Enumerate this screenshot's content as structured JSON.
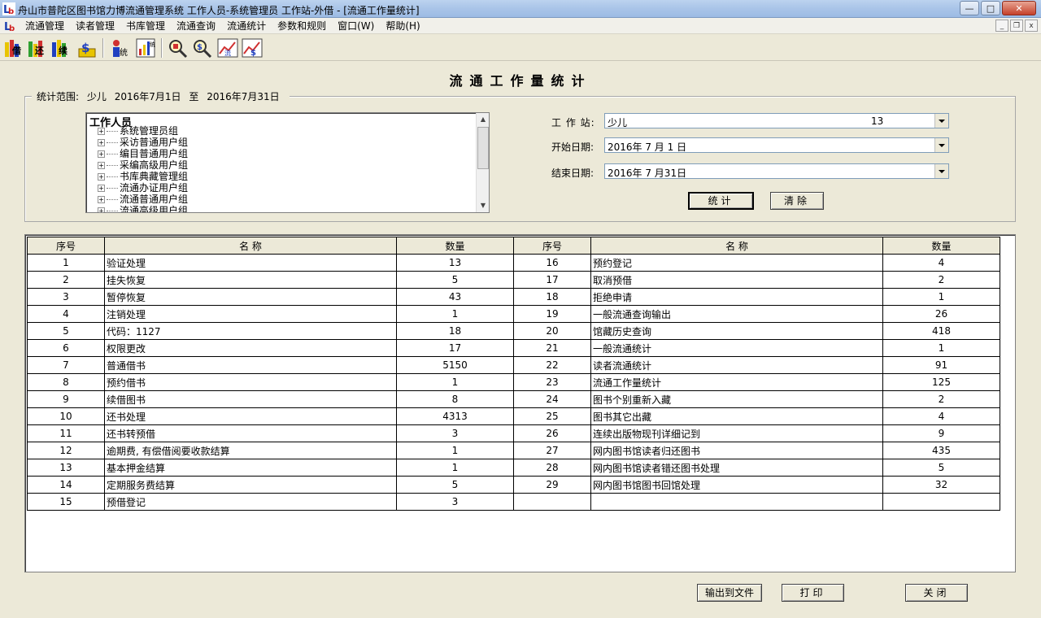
{
  "window": {
    "title": "舟山市普陀区图书馆力博流通管理系统 工作人员-系统管理员 工作站-外借 - [流通工作量统计]",
    "btn_min": "—",
    "btn_max": "□",
    "btn_close": "✕"
  },
  "menu": {
    "items": [
      "流通管理",
      "读者管理",
      "书库管理",
      "流通查询",
      "流通统计",
      "参数和规则",
      "窗口(W)",
      "帮助(H)"
    ],
    "mdi_min": "_",
    "mdi_restore": "❐",
    "mdi_close": "x"
  },
  "toolbar": {
    "icons": [
      "lend-icon",
      "return-icon",
      "renew-icon",
      "fee-icon",
      "reader-stats-icon",
      "stats-chart-icon",
      "search-book-icon",
      "search-fee-icon",
      "circulation-stats-icon",
      "fee-stats-icon"
    ],
    "labels": [
      "借",
      "还",
      "续",
      "$",
      "统",
      "统",
      "",
      "$",
      "流",
      "$"
    ]
  },
  "form": {
    "title": "流通工作量统计",
    "range_label": "统计范围:",
    "range_location": "少儿",
    "range_start": "2016年7月1日",
    "range_to": "至",
    "range_end": "2016年7月31日"
  },
  "tree": {
    "root": "工作人员",
    "nodes": [
      "系统管理员组",
      "采访普通用户组",
      "编目普通用户组",
      "采编高级用户组",
      "书库典藏管理组",
      "流通办证用户组",
      "流通普通用户组",
      "流通高级用户组"
    ]
  },
  "fields": {
    "station_label": "工 作 站:",
    "station_value": "少儿",
    "station_code": "13",
    "start_label": "开始日期:",
    "start_value": "2016年 7 月 1 日",
    "end_label": "结束日期:",
    "end_value": "2016年 7 月31日"
  },
  "buttons": {
    "stat": "统计",
    "clear": "清除",
    "export": "输出到文件",
    "print": "打印",
    "close": "关闭"
  },
  "grid": {
    "headers": [
      "序号",
      "名  称",
      "数量",
      "序号",
      "名  称",
      "数量"
    ],
    "rows": [
      [
        "1",
        "验证处理",
        "13",
        "16",
        "预约登记",
        "4"
      ],
      [
        "2",
        "挂失恢复",
        "5",
        "17",
        "取消预借",
        "2"
      ],
      [
        "3",
        "暂停恢复",
        "43",
        "18",
        "拒绝申请",
        "1"
      ],
      [
        "4",
        "注销处理",
        "1",
        "19",
        "一般流通查询输出",
        "26"
      ],
      [
        "5",
        "代码：1127",
        "18",
        "20",
        "馆藏历史查询",
        "418"
      ],
      [
        "6",
        "权限更改",
        "17",
        "21",
        "一般流通统计",
        "1"
      ],
      [
        "7",
        "普通借书",
        "5150",
        "22",
        "读者流通统计",
        "91"
      ],
      [
        "8",
        "预约借书",
        "1",
        "23",
        "流通工作量统计",
        "125"
      ],
      [
        "9",
        "续借图书",
        "8",
        "24",
        "图书个别重新入藏",
        "2"
      ],
      [
        "10",
        "还书处理",
        "4313",
        "25",
        "图书其它出藏",
        "4"
      ],
      [
        "11",
        "还书转预借",
        "3",
        "26",
        "连续出版物现刊详细记到",
        "9"
      ],
      [
        "12",
        "逾期费, 有偿借阅要收款结算",
        "1",
        "27",
        "网内图书馆读者归还图书",
        "435"
      ],
      [
        "13",
        "基本押金结算",
        "1",
        "28",
        "网内图书馆读者错还图书处理",
        "5"
      ],
      [
        "14",
        "定期服务费结算",
        "5",
        "29",
        "网内图书馆图书回馆处理",
        "32"
      ],
      [
        "15",
        "预借登记",
        "3",
        "",
        "",
        ""
      ]
    ]
  }
}
